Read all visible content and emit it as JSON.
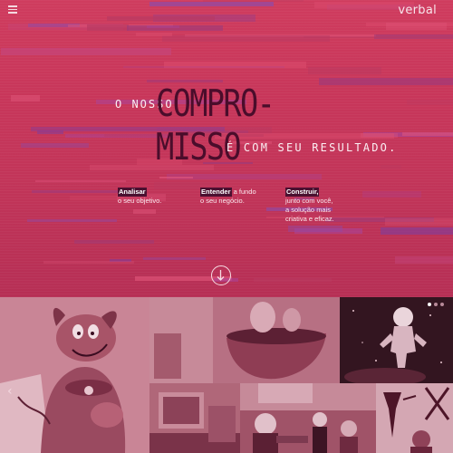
{
  "header": {
    "brand": "verbal",
    "menu_icon": "hamburger-menu-icon"
  },
  "hero": {
    "line1_prefix": "O nosso",
    "big_word_1": "COMPRO-",
    "big_word_2": "MISSO",
    "line2_suffix": "é com seu resultado.",
    "columns": [
      {
        "title": "Analisar",
        "text": "o seu objetivo."
      },
      {
        "title": "Entender",
        "title_suffix": " a fundo",
        "text": "o seu negócio."
      },
      {
        "title": "Construir,",
        "text_lines": [
          "junto com você,",
          "a solução mais",
          "criativa e eficaz."
        ]
      }
    ],
    "scroll_icon": "arrow-down-circle-icon"
  },
  "gallery": {
    "tiles": [
      "scooby-doo-illustration",
      "bowl-photo",
      "astronaut-illustration",
      "room-photo",
      "kids-photo",
      "tools-illustration"
    ],
    "dots": {
      "count": 3,
      "active_index": 0
    },
    "prev_icon": "chevron-left-icon",
    "prev_symbol": "‹"
  },
  "colors": {
    "hero_bg": "#c7365a",
    "title_dark": "#4a0d2b",
    "gallery_tint": "#9c5064",
    "text_light": "#fbeff3"
  }
}
